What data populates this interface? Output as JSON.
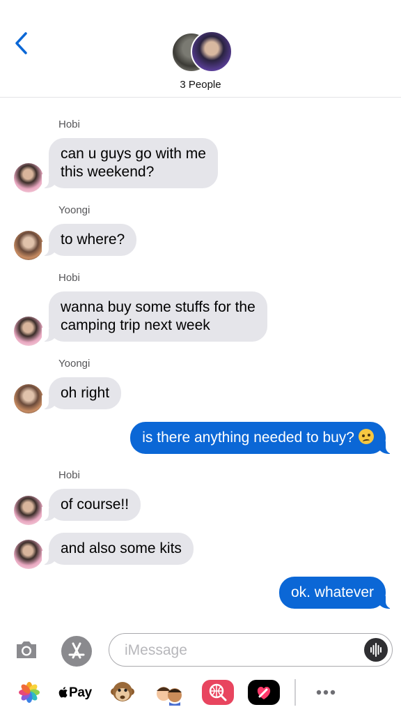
{
  "header": {
    "title": "3 People"
  },
  "messages": [
    {
      "sender": "Hobi",
      "text": "can u guys go with me\nthis weekend?"
    },
    {
      "sender": "Yoongi",
      "text": "to where?"
    },
    {
      "sender": "Hobi",
      "text": "wanna buy some stuffs for the\ncamping trip next week"
    },
    {
      "sender": "Yoongi",
      "text": "oh right"
    },
    {
      "text": "is there anything needed to buy?",
      "emoji": "woozy-face-emoji"
    },
    {
      "sender": "Hobi",
      "text": "of course!!"
    },
    {
      "text": "and also some kits"
    },
    {
      "text": "ok. whatever"
    }
  ],
  "composer": {
    "placeholder": "iMessage"
  },
  "apps": {
    "apple_pay_label": "Pay"
  },
  "colors": {
    "outgoing": "#0b67d6",
    "incoming": "#e5e5ea",
    "back_arrow": "#0b67d6"
  }
}
